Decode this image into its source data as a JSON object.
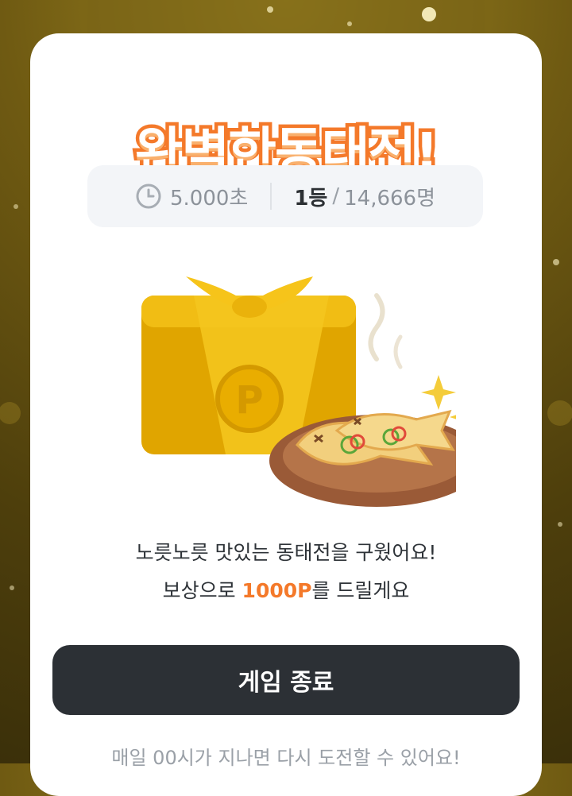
{
  "result": {
    "title": "완벽한동태전!",
    "time": "5.000초",
    "rank": "1등",
    "participants": "14,666명",
    "message_line1": "노릇노릇 맛있는 동태전을 구웠어요!",
    "message_prefix": "보상으로 ",
    "points": "1000P",
    "message_suffix": "를 드릴게요",
    "end_button": "게임 종료",
    "footer": "매일 00시가 지나면 다시 도전할 수 있어요!",
    "gift_letter": "P"
  },
  "icons": {
    "clock": "clock-icon",
    "gift": "gift-box-icon",
    "fish": "fish-pancake-icon",
    "sparkle": "sparkle-icon"
  },
  "colors": {
    "accent": "#f4792a",
    "button": "#2c3035",
    "gold": "#e7b300"
  }
}
